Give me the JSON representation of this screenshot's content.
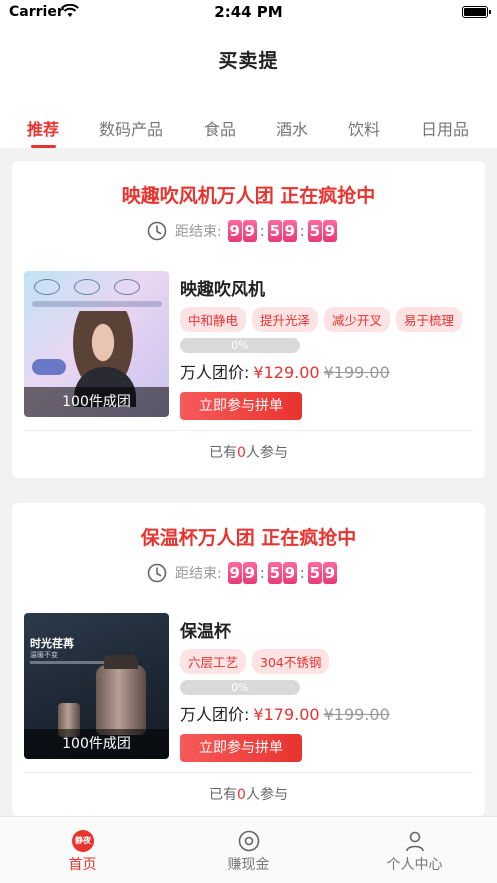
{
  "status_bar": {
    "carrier": "Carrier",
    "time": "2:44 PM"
  },
  "nav": {
    "title": "买卖提"
  },
  "tabs": [
    {
      "label": "推荐",
      "active": true
    },
    {
      "label": "数码产品",
      "active": false
    },
    {
      "label": "食品",
      "active": false
    },
    {
      "label": "酒水",
      "active": false
    },
    {
      "label": "饮料",
      "active": false
    },
    {
      "label": "日用品",
      "active": false
    }
  ],
  "countdown_label": "距结束:",
  "deals": [
    {
      "title": "映趣吹风机万人团 正在疯抢中",
      "countdown": [
        "9",
        "9",
        "5",
        "9",
        "5",
        "9"
      ],
      "product_name": "映趣吹风机",
      "tags": [
        "中和静电",
        "提升光泽",
        "减少开叉",
        "易于梳理"
      ],
      "badge": "100件成团",
      "progress_label": "0%",
      "progress_value": 0,
      "price_label": "万人团价:",
      "price": "¥129.00",
      "old_price": "¥199.00",
      "button": "立即参与拼单",
      "participants_prefix": "已有",
      "participants_count": "0",
      "participants_suffix": "人参与"
    },
    {
      "title": "保温杯万人团 正在疯抢中",
      "countdown": [
        "9",
        "9",
        "5",
        "9",
        "5",
        "9"
      ],
      "product_name": "保温杯",
      "tags": [
        "六层工艺",
        "304不锈钢"
      ],
      "badge": "100件成团",
      "image_text": "时光荏苒",
      "image_subtext": "温暖不变",
      "progress_label": "0%",
      "progress_value": 0,
      "price_label": "万人团价:",
      "price": "¥179.00",
      "old_price": "¥199.00",
      "button": "立即参与拼单",
      "participants_prefix": "已有",
      "participants_count": "0",
      "participants_suffix": "人参与"
    }
  ],
  "bottom_nav": [
    {
      "label": "首页",
      "icon": "home-icon",
      "icon_text": "静夜",
      "active": true
    },
    {
      "label": "赚现金",
      "icon": "earn-icon",
      "active": false
    },
    {
      "label": "个人中心",
      "icon": "profile-icon",
      "active": false
    }
  ],
  "colors": {
    "accent": "#e8332f",
    "tag_bg": "#fde3e3",
    "digit_pink": "#ff6aa0"
  }
}
